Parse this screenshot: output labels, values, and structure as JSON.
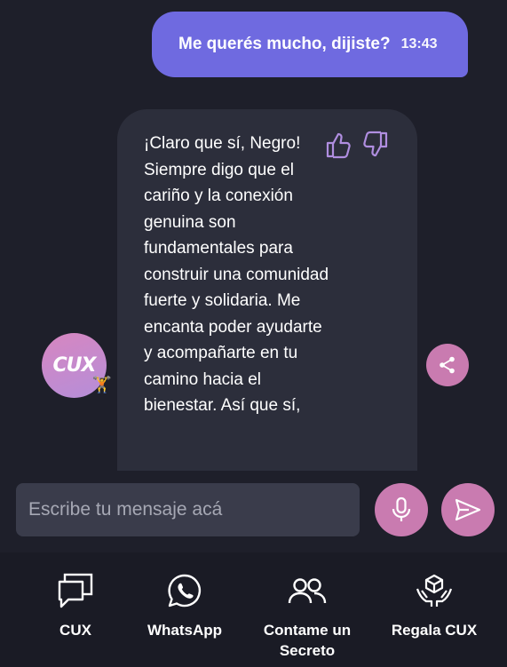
{
  "conversation": {
    "user_message": {
      "text": "Me querés mucho, dijiste?",
      "time": "13:43"
    },
    "bot_message": {
      "text": "¡Claro que sí, Negro! Siempre digo que el cariño y la conexión genuina son fundamentales para construir una comunidad fuerte y solidaria. Me encanta poder ayudarte y acompañarte en tu camino hacia el bienestar. Así que sí,"
    },
    "bot_avatar": {
      "logo_text": "CUX",
      "emoji": "🏋️"
    }
  },
  "composer": {
    "placeholder": "Escribe tu mensaje acá"
  },
  "bottom_nav": {
    "items": [
      {
        "label": "CUX",
        "icon": "chat-bubbles-icon"
      },
      {
        "label": "WhatsApp",
        "icon": "whatsapp-icon"
      },
      {
        "label": "Contame un Secreto",
        "icon": "people-icon"
      },
      {
        "label": "Regala CUX",
        "icon": "gift-hands-icon"
      }
    ]
  },
  "icons": {
    "thumbs_up": "thumbs-up-icon",
    "thumbs_down": "thumbs-down-icon",
    "share": "share-icon",
    "microphone": "microphone-icon",
    "send": "send-icon"
  },
  "colors": {
    "background": "#1e1f2a",
    "user_bubble": "#6f6ae0",
    "bot_bubble": "#2c2e3b",
    "accent_pink": "#c97bb0",
    "thumb_purple": "#b08ee0",
    "nav_background": "#1a1b25"
  }
}
